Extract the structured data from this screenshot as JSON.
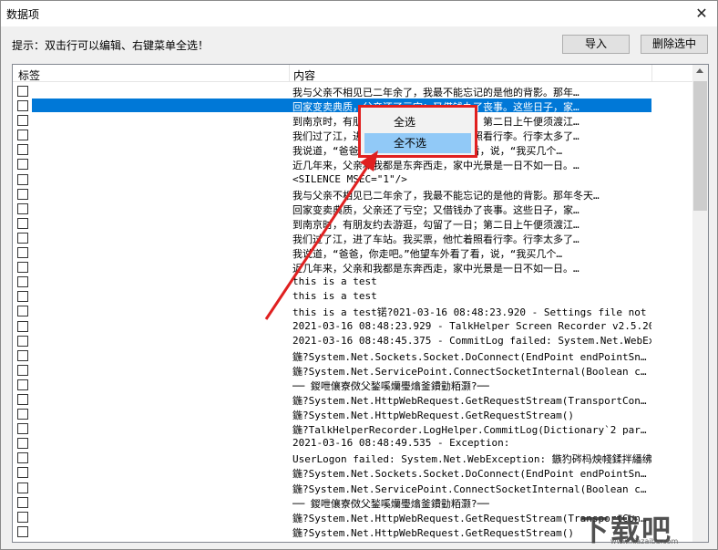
{
  "window": {
    "title": "数据项",
    "close": "✕"
  },
  "toolbar": {
    "hint": "提示：双击行可以编辑、右键菜单全选！",
    "import_label": "导入",
    "delete_label": "删除选中"
  },
  "table": {
    "columns": [
      "标签",
      "内容"
    ],
    "rows": [
      "     我与父亲不相见已二年余了，我最不能忘记的是他的背影。那年…",
      "     回家变卖典质，父亲还了亏空；又借钱办了丧事。这些日子，家…",
      "     到南京时，有朋友约去游逛，勾留了一日；第二日上午便须渡江…",
      "     我们过了江，进了车站。我买票，他忙着照看行李。行李太多了…",
      "     我说道，“爸爸，你走吧。”他望车外看了看，说，“我买几个…",
      "     近几年来，父亲和我都是东奔西走，家中光景是一日不如一日。…",
      "<SILENCE MSEC=\"1\"/>",
      "我与父亲不相见已二年余了，我最不能忘记的是他的背影。那年冬天…",
      "     回家变卖典质，父亲还了亏空；又借钱办了丧事。这些日子，家…",
      "     到南京时，有朋友约去游逛，勾留了一日；第二日上午便须渡江…",
      "     我们过了江，进了车站。我买票，他忙着照看行李。行李太多了…",
      "     我说道，“爸爸，你走吧。”他望车外看了看，说，“我买几个…",
      "     近几年来，父亲和我都是东奔西走，家中光景是一日不如一日。…",
      "this is a test",
      "this is a test",
      "this is a test锘?021-03-16 08:48:23.920 - Settings file not f…",
      "2021-03-16 08:48:23.929 - TalkHelper Screen Recorder v2.5.20.…",
      "2021-03-16 08:48:45.375 - CommitLog failed: System.Net.WebExc…",
      "   鍦?System.Net.Sockets.Socket.DoConnect(EndPoint endPointSn…",
      "   鍦?System.Net.ServicePoint.ConnectSocketInternal(Boolean c…",
      "   ── 鍐呭儴寮傚父鍫嗘爤璺熻釜鐨勭粨灏?──",
      "   鍦?System.Net.HttpWebRequest.GetRequestStream(TransportCon…",
      "   鍦?System.Net.HttpWebRequest.GetRequestStream()",
      "   鍦?TalkHelperRecorder.LogHelper.CommitLog(Dictionary`2 par…",
      "2021-03-16 08:48:49.535 - Exception:",
      "UserLogon failed: System.Net.WebException: 鏃犳硶杩炴帴鍒拌繙绋…",
      "   鍦?System.Net.Sockets.Socket.DoConnect(EndPoint endPointSn…",
      "   鍦?System.Net.ServicePoint.ConnectSocketInternal(Boolean c…",
      "   ── 鍐呭儴寮傚父鍫嗘爤璺熻釜鐨勭粨灏?──",
      "   鍦?System.Net.HttpWebRequest.GetRequestStream(TransportCon…",
      "   鍦?System.Net.HttpWebRequest.GetRequestStream()"
    ],
    "selected_row": 1
  },
  "context_menu": {
    "items": [
      "全选",
      "全不选"
    ],
    "highlighted": 1
  },
  "watermark": {
    "text": "下载吧",
    "url": "www.xiazaiba.com"
  },
  "colors": {
    "selection": "#0078d7",
    "highlight": "#91c9f7",
    "annotation": "#e02020"
  }
}
